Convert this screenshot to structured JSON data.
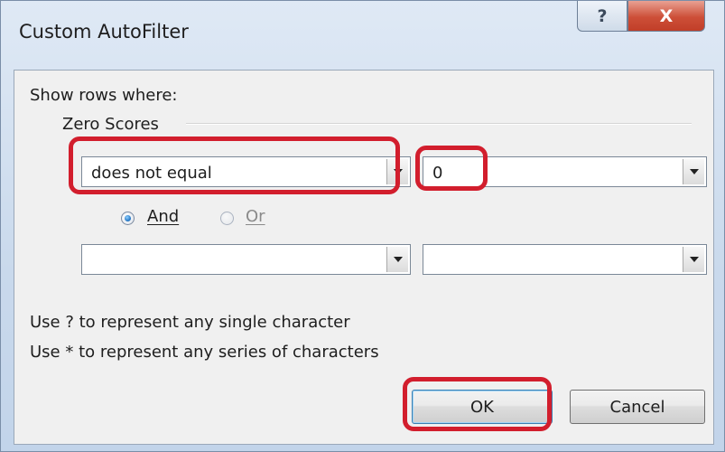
{
  "window": {
    "title": "Custom AutoFilter",
    "help_glyph": "?",
    "close_glyph": "X"
  },
  "dialog": {
    "show_rows_label": "Show rows where:",
    "field_name": "Zero Scores",
    "criteria1": {
      "operator": "does not equal",
      "value": "0"
    },
    "logic": {
      "and_label": "And",
      "or_label": "Or",
      "selected": "And"
    },
    "criteria2": {
      "operator": "",
      "value": ""
    },
    "hint_single": "Use ? to represent any single character",
    "hint_series": "Use * to represent any series of characters",
    "ok_label": "OK",
    "cancel_label": "Cancel"
  },
  "annotations": {
    "highlight_color": "#d21e2d",
    "highlighted": [
      "operator-combo-1",
      "value-combo-1",
      "ok-button"
    ]
  }
}
